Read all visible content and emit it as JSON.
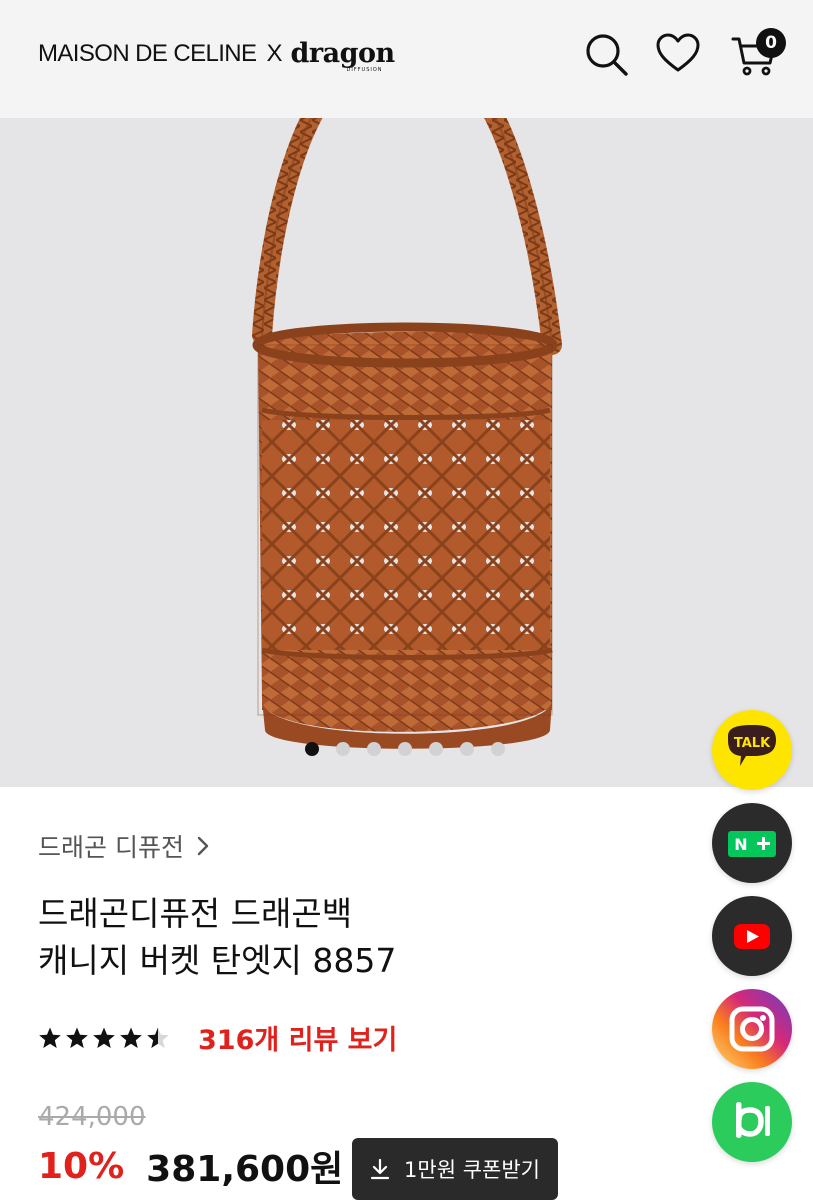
{
  "header": {
    "brand_text": "MAISON DE CELINE",
    "brand_x": "X",
    "logo_word": "dragon",
    "logo_sub": "DIFFUSION",
    "cart_count": "0"
  },
  "gallery": {
    "slide_count": 7,
    "active_slide": 1
  },
  "product": {
    "brand_link": "드래곤 디퓨전",
    "title_line1": "드래곤디퓨전 드래곤백",
    "title_line2": "캐니지 버켓 탄엣지 8857",
    "rating": 4.5,
    "review_link": "316개 리뷰 보기",
    "original_price": "424,000",
    "discount": "10%",
    "price": "381,600원",
    "coupon_label": "1만원 쿠폰받기"
  },
  "floating": {
    "kakao_label": "TALK",
    "naver_label": "N"
  },
  "colors": {
    "accent_red": "#e0211c",
    "kakao_yellow": "#fee500",
    "naver_green": "#03c75a",
    "youtube_red": "#ff0000",
    "band_green": "#2bcb5c",
    "bag_leather": "#b05a2a"
  }
}
